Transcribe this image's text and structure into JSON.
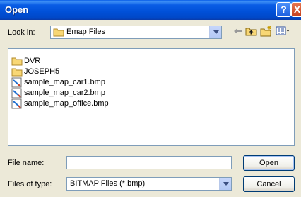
{
  "window": {
    "title": "Open"
  },
  "titlebar": {
    "help_label": "?",
    "close_label": "X"
  },
  "lookin": {
    "label": "Look in:",
    "value": "Emap Files"
  },
  "files": [
    {
      "name": "DVR",
      "type": "folder"
    },
    {
      "name": "JOSEPH5",
      "type": "folder"
    },
    {
      "name": "sample_map_car1.bmp",
      "type": "bitmap"
    },
    {
      "name": "sample_map_car2.bmp",
      "type": "bitmap"
    },
    {
      "name": "sample_map_office.bmp",
      "type": "bitmap"
    }
  ],
  "filename": {
    "label": "File name:",
    "value": ""
  },
  "filetype": {
    "label": "Files of type:",
    "value": "BITMAP Files (*.bmp)"
  },
  "buttons": {
    "open": "Open",
    "cancel": "Cancel"
  },
  "icons": {
    "back": "back-arrow-icon",
    "up": "up-folder-icon",
    "new_folder": "new-folder-icon",
    "views": "views-menu-icon"
  }
}
